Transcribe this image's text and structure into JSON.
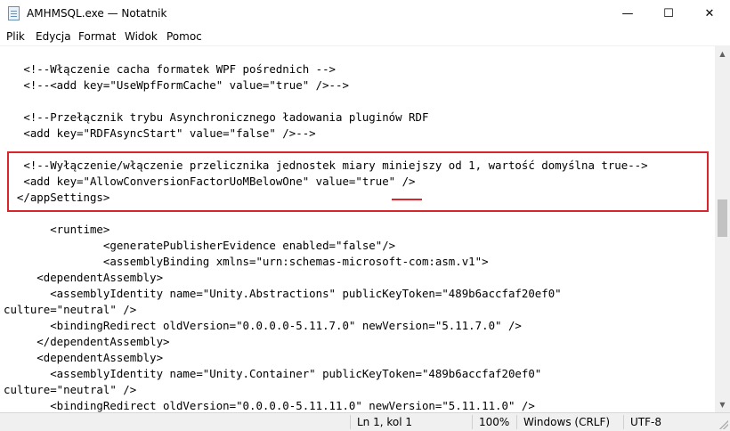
{
  "window": {
    "title": "AMHMSQL.exe — Notatnik",
    "minimize_glyph": "—",
    "maximize_glyph": "☐",
    "close_glyph": "✕",
    "icon": "notepad-icon"
  },
  "menu": [
    "Plik",
    "Edycja",
    "Format",
    "Widok",
    "Pomoc"
  ],
  "editor": {
    "lines": [
      "   <!--Włączenie cacha formatek WPF pośrednich -->",
      "   <!--<add key=\"UseWpfFormCache\" value=\"true\" />-->",
      "",
      "   <!--Przełącznik trybu Asynchronicznego ładowania pluginów RDF",
      "   <add key=\"RDFAsyncStart\" value=\"false\" />-->",
      "",
      "   <!--Wyłączenie/włączenie przelicznika jednostek miary miniejszy od 1, wartość domyślna true-->",
      "   <add key=\"AllowConversionFactorUoMBelowOne\" value=\"true\" />",
      "  </appSettings>",
      "",
      "       <runtime>",
      "               <generatePublisherEvidence enabled=\"false\"/>",
      "               <assemblyBinding xmlns=\"urn:schemas-microsoft-com:asm.v1\">",
      "     <dependentAssembly>",
      "       <assemblyIdentity name=\"Unity.Abstractions\" publicKeyToken=\"489b6accfaf20ef0\"",
      "culture=\"neutral\" />",
      "       <bindingRedirect oldVersion=\"0.0.0.0-5.11.7.0\" newVersion=\"5.11.7.0\" />",
      "     </dependentAssembly>",
      "     <dependentAssembly>",
      "       <assemblyIdentity name=\"Unity.Container\" publicKeyToken=\"489b6accfaf20ef0\"",
      "culture=\"neutral\" />",
      "       <bindingRedirect oldVersion=\"0.0.0.0-5.11.11.0\" newVersion=\"5.11.11.0\" />"
    ],
    "highlight_color": "#d9262c"
  },
  "scrollbar": {
    "up_glyph": "▲",
    "down_glyph": "▼"
  },
  "status": {
    "position": "Ln 1, kol 1",
    "zoom": "100%",
    "line_ending": "Windows (CRLF)",
    "encoding": "UTF-8"
  }
}
